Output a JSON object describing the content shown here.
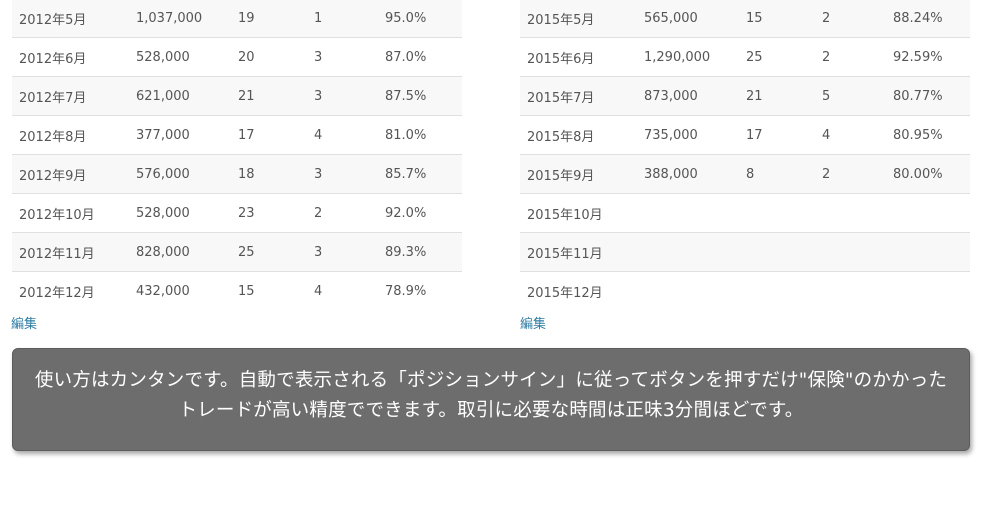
{
  "left_table": {
    "rows": [
      [
        "2012年5月",
        "1,037,000",
        "19",
        "1",
        "95.0%"
      ],
      [
        "2012年6月",
        "528,000",
        "20",
        "3",
        "87.0%"
      ],
      [
        "2012年7月",
        "621,000",
        "21",
        "3",
        "87.5%"
      ],
      [
        "2012年8月",
        "377,000",
        "17",
        "4",
        "81.0%"
      ],
      [
        "2012年9月",
        "576,000",
        "18",
        "3",
        "85.7%"
      ],
      [
        "2012年10月",
        "528,000",
        "23",
        "2",
        "92.0%"
      ],
      [
        "2012年11月",
        "828,000",
        "25",
        "3",
        "89.3%"
      ],
      [
        "2012年12月",
        "432,000",
        "15",
        "4",
        "78.9%"
      ]
    ],
    "edit_label": "編集"
  },
  "right_table": {
    "rows": [
      [
        "2015年5月",
        "565,000",
        "15",
        "2",
        "88.24%"
      ],
      [
        "2015年6月",
        "1,290,000",
        "25",
        "2",
        "92.59%"
      ],
      [
        "2015年7月",
        "873,000",
        "21",
        "5",
        "80.77%"
      ],
      [
        "2015年8月",
        "735,000",
        "17",
        "4",
        "80.95%"
      ],
      [
        "2015年9月",
        "388,000",
        "8",
        "2",
        "80.00%"
      ],
      [
        "2015年10月",
        "",
        "",
        "",
        ""
      ],
      [
        "2015年11月",
        "",
        "",
        "",
        ""
      ],
      [
        "2015年12月",
        "",
        "",
        "",
        ""
      ]
    ],
    "edit_label": "編集"
  },
  "notice": {
    "text": "使い方はカンタンです。自動で表示される「ポジションサイン」に従ってボタンを押すだけ\"保険\"のかかったトレードが高い精度でできます。取引に必要な時間は正味3分間ほどです。"
  },
  "colors": {
    "link": "#2f7ea4",
    "notice_bg": "#6d6d6d",
    "row_stripe": "#f8f8f8"
  }
}
